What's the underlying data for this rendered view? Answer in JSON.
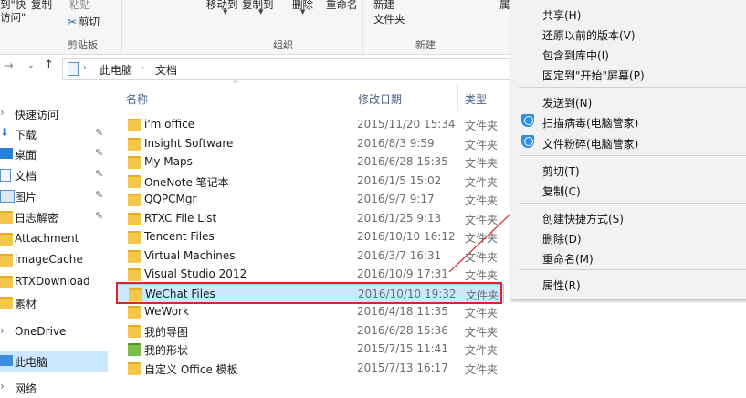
{
  "ribbon": {
    "partial_left_top": "到\"快",
    "partial_left_bottom": "访问\"",
    "copy_label": "复制",
    "paste_label": "粘贴",
    "cut_label": "剪切",
    "clipboard_group": "剪贴板",
    "move_to_label": "移动到",
    "copy_to_label": "复制到",
    "delete_label": "删除",
    "rename_label": "重命名",
    "organize_group": "组织",
    "new_folder_label_1": "新建",
    "new_folder_label_2": "文件夹",
    "new_group": "新建",
    "partial_right": "属"
  },
  "address": {
    "crumbs": [
      "此电脑",
      "文档"
    ]
  },
  "nav": {
    "items": [
      {
        "label": "快速访问",
        "icon": "star-icon",
        "pin": false
      },
      {
        "label": "下载",
        "icon": "download-icon",
        "pin": true
      },
      {
        "label": "桌面",
        "icon": "desktop-icon",
        "pin": true
      },
      {
        "label": "文档",
        "icon": "document-icon",
        "pin": true
      },
      {
        "label": "图片",
        "icon": "picture-icon",
        "pin": true
      },
      {
        "label": "日志解密",
        "icon": "folder-icon",
        "pin": true
      },
      {
        "label": "Attachment",
        "icon": "folder-icon",
        "pin": false
      },
      {
        "label": "imageCache",
        "icon": "folder-icon",
        "pin": false
      },
      {
        "label": "RTXDownload",
        "icon": "folder-icon",
        "pin": false
      },
      {
        "label": "素材",
        "icon": "folder-icon",
        "pin": false
      },
      {
        "label": "OneDrive",
        "icon": "cloud-icon",
        "pin": false
      },
      {
        "label": "此电脑",
        "icon": "computer-icon",
        "pin": false
      },
      {
        "label": "网络",
        "icon": "network-icon",
        "pin": false
      }
    ]
  },
  "list": {
    "columns": {
      "name": "名称",
      "date": "修改日期",
      "type": "类型"
    },
    "rows": [
      {
        "name": "i'm office",
        "date": "2015/11/20 15:34",
        "type": "文件夹"
      },
      {
        "name": "Insight Software",
        "date": "2016/8/3 9:59",
        "type": "文件夹"
      },
      {
        "name": "My Maps",
        "date": "2016/6/28 15:35",
        "type": "文件夹"
      },
      {
        "name": "OneNote 笔记本",
        "date": "2016/1/5 15:02",
        "type": "文件夹"
      },
      {
        "name": "QQPCMgr",
        "date": "2016/9/7 9:17",
        "type": "文件夹"
      },
      {
        "name": "RTXC File List",
        "date": "2016/1/25 9:13",
        "type": "文件夹"
      },
      {
        "name": "Tencent Files",
        "date": "2016/10/10 16:12",
        "type": "文件夹"
      },
      {
        "name": "Virtual Machines",
        "date": "2016/3/7 16:31",
        "type": "文件夹"
      },
      {
        "name": "Visual Studio 2012",
        "date": "2016/10/9 17:31",
        "type": "文件夹"
      },
      {
        "name": "WeChat Files",
        "date": "2016/10/10 19:32",
        "type": "文件夹"
      },
      {
        "name": "WeWork",
        "date": "2016/4/18 11:35",
        "type": "文件夹"
      },
      {
        "name": "我的导图",
        "date": "2016/6/28 15:36",
        "type": "文件夹"
      },
      {
        "name": "我的形状",
        "date": "2015/7/15 11:41",
        "type": "文件夹"
      },
      {
        "name": "自定义 Office 模板",
        "date": "2015/7/13 16:17",
        "type": "文件夹"
      }
    ]
  },
  "menu": {
    "items": [
      {
        "label": "共享(H)"
      },
      {
        "label": "还原以前的版本(V)"
      },
      {
        "label": "包含到库中(I)"
      },
      {
        "label": "固定到\"开始\"屏幕(P)"
      },
      {
        "label": "发送到(N)"
      },
      {
        "label": "扫描病毒(电脑管家)"
      },
      {
        "label": "文件粉碎(电脑管家)"
      },
      {
        "label": "剪切(T)"
      },
      {
        "label": "复制(C)"
      },
      {
        "label": "创建快捷方式(S)"
      },
      {
        "label": "删除(D)"
      },
      {
        "label": "重命名(M)"
      },
      {
        "label": "属性(R)"
      }
    ]
  },
  "colors": {
    "selection": "#cce8ff",
    "highlight_border": "#d5262b",
    "folder": "#f4c64c",
    "accent": "#2f8ee6"
  }
}
